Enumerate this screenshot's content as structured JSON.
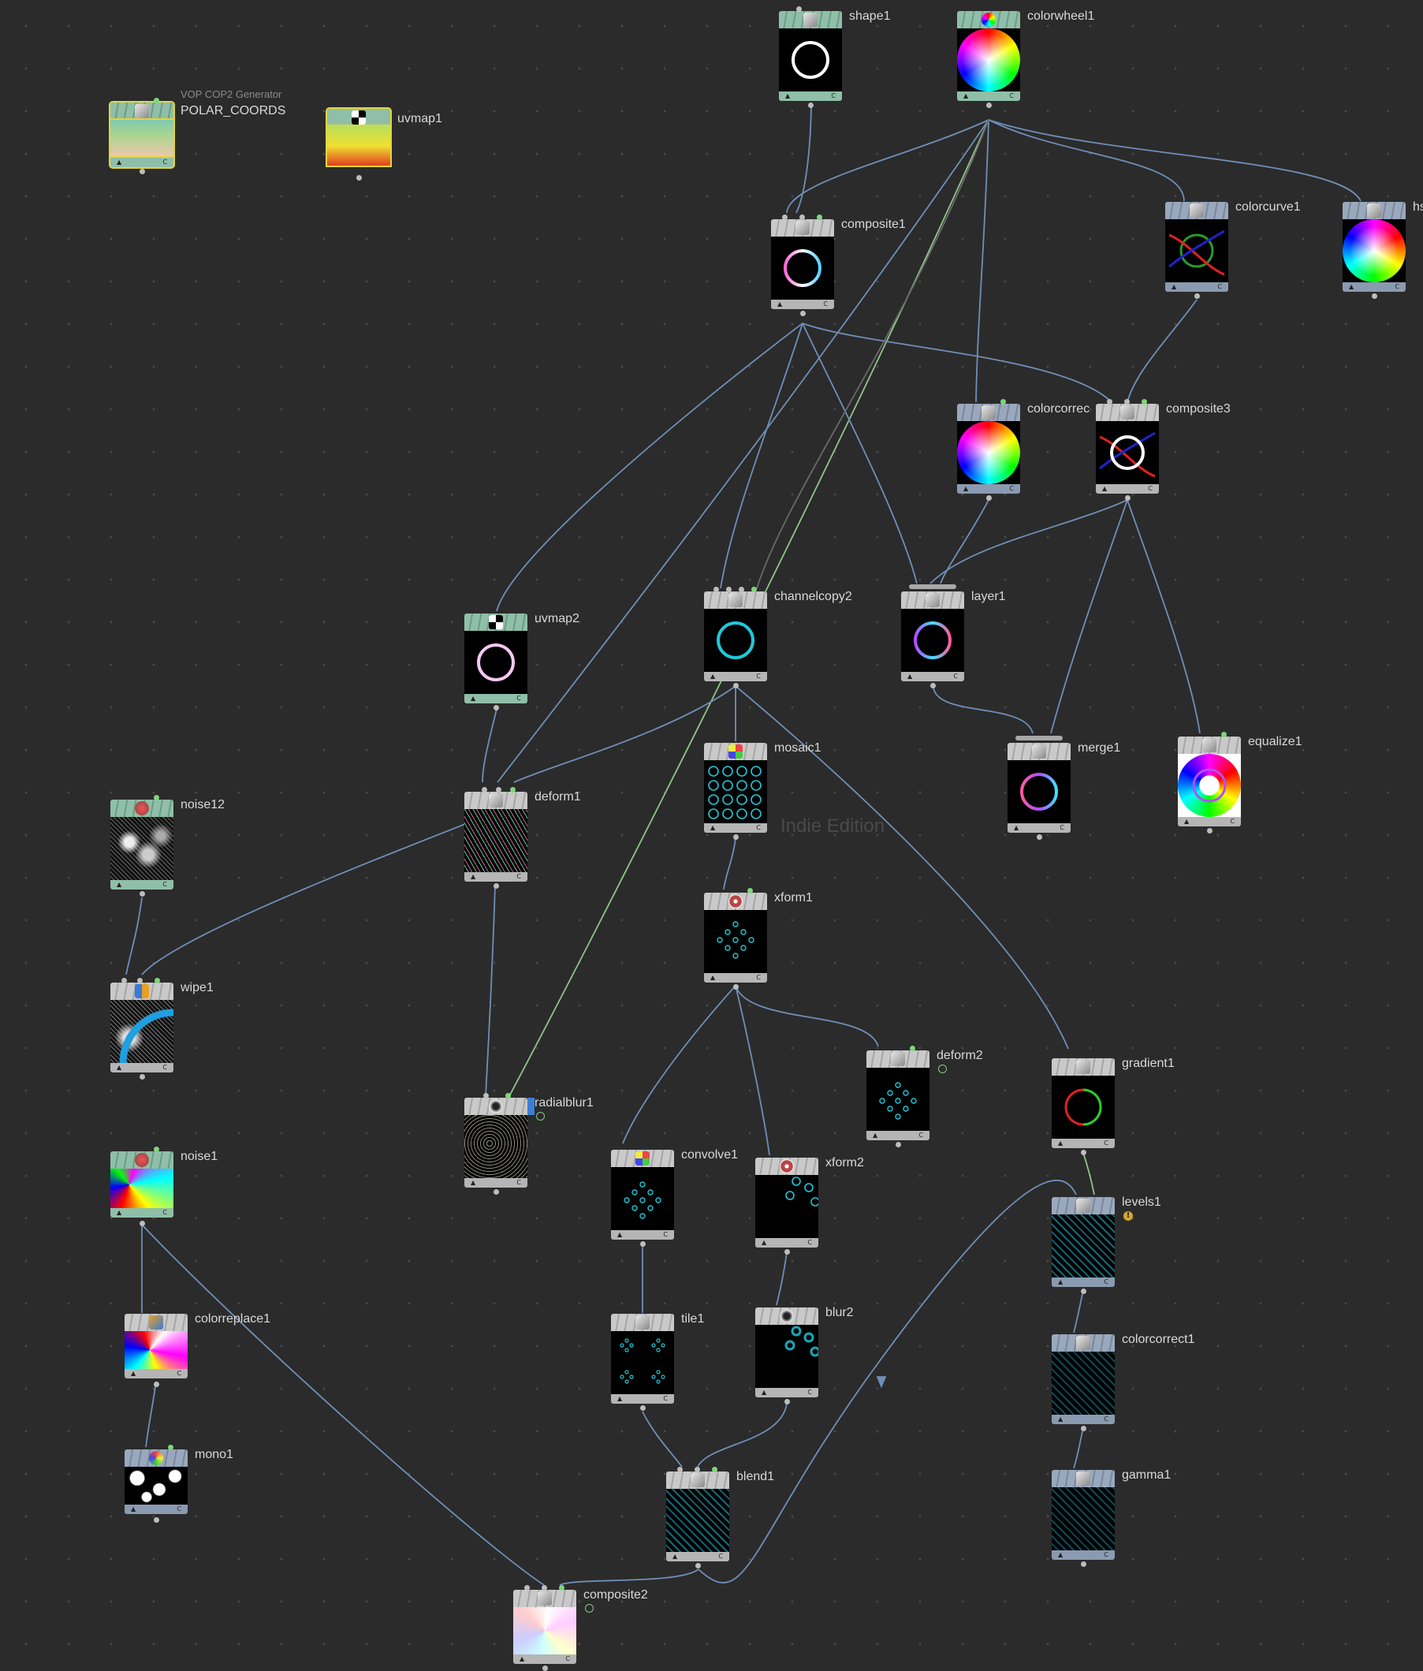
{
  "network": {
    "watermark": "Indie Edition",
    "nodes": {
      "polar_coords": {
        "label": "POLAR_COORDS",
        "sublabel": "VOP COP2 Generator"
      },
      "uvmap1": {
        "label": "uvmap1"
      },
      "shape1": {
        "label": "shape1"
      },
      "colorwheel1": {
        "label": "colorwheel1"
      },
      "composite1": {
        "label": "composite1"
      },
      "colorcurve1": {
        "label": "colorcurve1"
      },
      "hsv": {
        "label": "hs"
      },
      "colorcorrect2": {
        "label": "colorcorrec"
      },
      "composite3": {
        "label": "composite3"
      },
      "uvmap2": {
        "label": "uvmap2"
      },
      "channelcopy2": {
        "label": "channelcopy2"
      },
      "layer1": {
        "label": "layer1"
      },
      "merge1": {
        "label": "merge1"
      },
      "equalize1": {
        "label": "equalize1"
      },
      "mosaic1": {
        "label": "mosaic1"
      },
      "deform1": {
        "label": "deform1"
      },
      "noise12": {
        "label": "noise12"
      },
      "xform1": {
        "label": "xform1"
      },
      "wipe1": {
        "label": "wipe1"
      },
      "deform2": {
        "label": "deform2"
      },
      "gradient1": {
        "label": "gradient1"
      },
      "radialblur1": {
        "label": "radialblur1"
      },
      "noise1": {
        "label": "noise1"
      },
      "convolve1": {
        "label": "convolve1"
      },
      "xform2": {
        "label": "xform2"
      },
      "levels1": {
        "label": "levels1"
      },
      "colorreplace1": {
        "label": "colorreplace1"
      },
      "tile1": {
        "label": "tile1"
      },
      "blur2": {
        "label": "blur2"
      },
      "colorcorrect1": {
        "label": "colorcorrect1"
      },
      "mono1": {
        "label": "mono1"
      },
      "blend1": {
        "label": "blend1"
      },
      "gamma1": {
        "label": "gamma1"
      },
      "composite2": {
        "label": "composite2"
      }
    },
    "footer": {
      "left": "▲",
      "right": "C"
    },
    "warning_glyph": "!"
  }
}
